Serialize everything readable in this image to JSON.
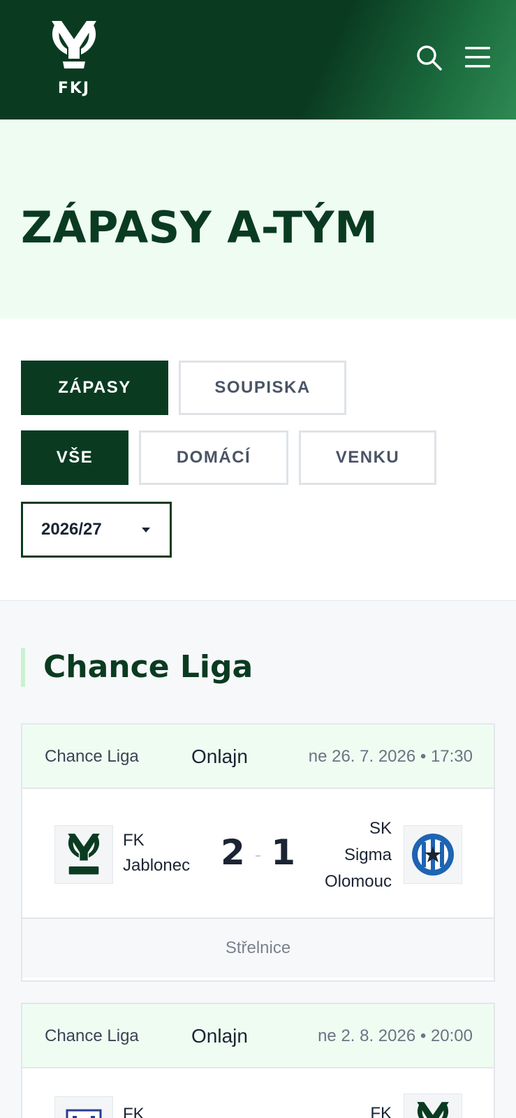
{
  "header": {
    "logo_text": "FKJ",
    "search_icon": "search-icon",
    "menu_icon": "hamburger-menu-icon",
    "colors": {
      "primary": "#0a3b21",
      "accent": "#2e8a52"
    }
  },
  "page": {
    "title": "ZÁPASY A-TÝM"
  },
  "filters": {
    "view_tabs": [
      {
        "label": "ZÁPASY",
        "active": true
      },
      {
        "label": "SOUPISKA",
        "active": false
      }
    ],
    "venue_tabs": [
      {
        "label": "VŠE",
        "active": true
      },
      {
        "label": "DOMÁCÍ",
        "active": false
      },
      {
        "label": "VENKU",
        "active": false
      }
    ],
    "season": {
      "selected": "2026/27"
    }
  },
  "section": {
    "title": "Chance Liga"
  },
  "matches": [
    {
      "competition": "Chance Liga",
      "broadcast": "Onlajn",
      "date": "ne 26. 7. 2026 • 17:30",
      "home": {
        "name_line1": "FK",
        "name_line2": "Jablonec",
        "crest": "fkj-crest-icon"
      },
      "away": {
        "name_line1": "SK",
        "name_line2": "Sigma",
        "name_line3": "Olomouc",
        "crest": "sigma-olomouc-crest-icon"
      },
      "score_home": "2",
      "score_sep": "-",
      "score_away": "1",
      "venue": "Střelnice"
    },
    {
      "competition": "Chance Liga",
      "broadcast": "Onlajn",
      "date": "ne 2. 8. 2026 • 20:00",
      "home": {
        "name_line1": "FK",
        "crest": "pardubice-crest-icon"
      },
      "away": {
        "name_line1": "FK",
        "crest": "fkj-crest-icon"
      }
    }
  ]
}
